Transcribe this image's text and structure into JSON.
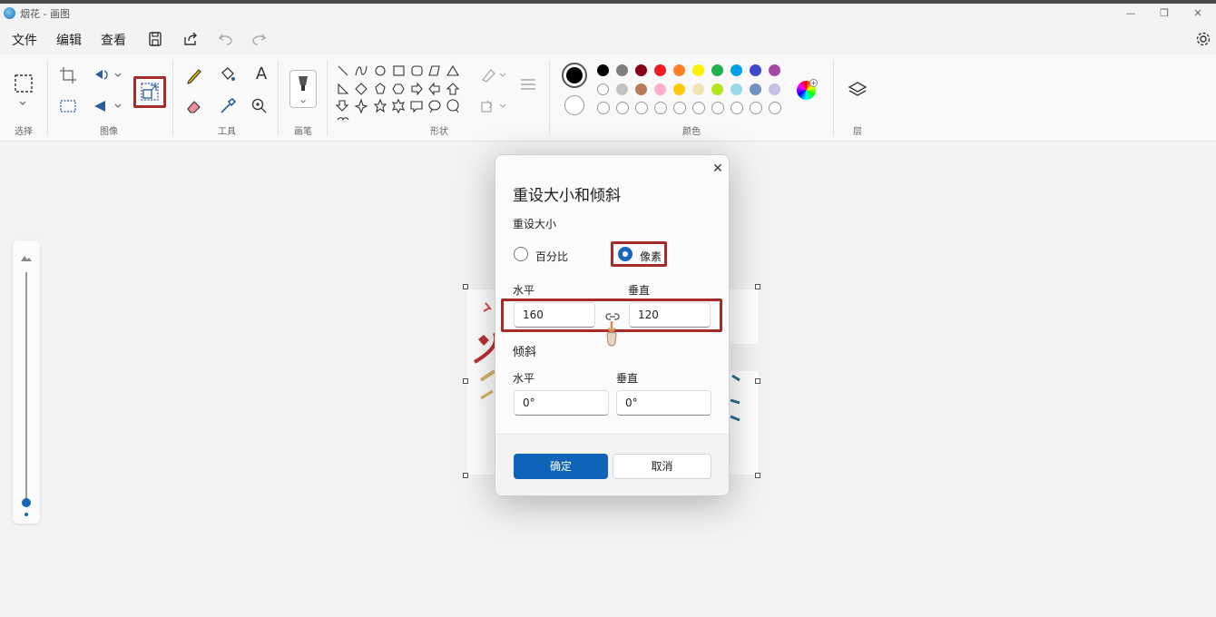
{
  "window": {
    "title": "烟花 - 画图",
    "minimize_glyph": "—",
    "maximize_glyph": "❐",
    "close_glyph": "✕"
  },
  "menu": {
    "items": [
      "文件",
      "编辑",
      "查看"
    ],
    "icons": [
      "save-icon",
      "share-icon",
      "undo-icon",
      "redo-icon"
    ],
    "settings_icon": "gear-icon"
  },
  "ribbon": {
    "groups": {
      "select": "选择",
      "image": "图像",
      "tools": "工具",
      "brushes": "画笔",
      "shapes": "形状",
      "colors": "颜色",
      "layers": "层"
    },
    "text_tool_glyph": "A",
    "colors": {
      "primary": "#000000",
      "secondary": "#ffffff",
      "palette_row1": [
        "#000000",
        "#7f7f7f",
        "#880015",
        "#ed1c24",
        "#ff7f27",
        "#fff200",
        "#22b14c",
        "#00a2e8",
        "#3f48cc",
        "#a349a4"
      ],
      "palette_row2": [
        "#ffffff",
        "#c3c3c3",
        "#b97a57",
        "#ffaec9",
        "#ffc90e",
        "#efe4b0",
        "#b5e61d",
        "#99d9ea",
        "#7092be",
        "#c8bfe7"
      ],
      "custom_slots": 10
    }
  },
  "dialog": {
    "title": "重设大小和倾斜",
    "close_glyph": "✕",
    "resize_section": "重设大小",
    "option_percent": "百分比",
    "option_pixels": "像素",
    "selected_option": "像素",
    "horizontal_label": "水平",
    "vertical_label": "垂直",
    "horizontal_value": "160",
    "vertical_value": "120",
    "skew_section": "倾斜",
    "skew_horizontal_label": "水平",
    "skew_vertical_label": "垂直",
    "skew_horizontal_value": "0°",
    "skew_vertical_value": "0°",
    "ok_label": "确定",
    "cancel_label": "取消"
  },
  "annotations": {
    "highlight_color": "#a72b2b"
  }
}
